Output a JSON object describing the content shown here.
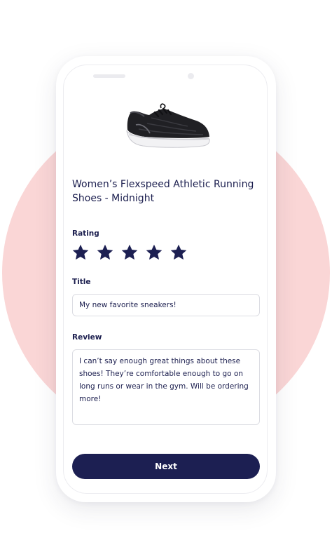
{
  "product": {
    "title": "Women’s Flexspeed Athletic Running Shoes - Midnight",
    "image_icon": "running-shoe"
  },
  "rating": {
    "label": "Rating",
    "value": 5,
    "max": 5
  },
  "title_field": {
    "label": "Title",
    "value": "My new favorite sneakers!"
  },
  "review_field": {
    "label": "Review",
    "value": "I can’t say enough great things about these shoes! They’re comfortable enough to go on long runs or wear in the gym. Will be ordering more!"
  },
  "next_button": {
    "label": "Next"
  },
  "colors": {
    "primary": "#1c1f52",
    "background_circle": "#fad6d6",
    "text": "#1c1f4f"
  }
}
